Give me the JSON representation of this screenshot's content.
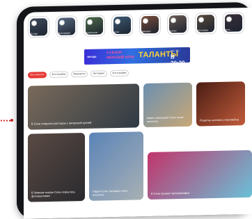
{
  "stories": [
    {
      "label": "Погода",
      "color": "#3f4a5a"
    },
    {
      "label": "Фотография",
      "color": "#5a6b83"
    },
    {
      "label": "Кыргызстан",
      "color": "#4e6b4a"
    },
    {
      "label": "Сочи",
      "color": "#3d5a74"
    },
    {
      "label": "Маршрут",
      "color": "#7a4d3a"
    },
    {
      "label": "Бизнес",
      "color": "#6a5a52"
    },
    {
      "label": "Рестораны",
      "color": "#574a3c"
    },
    {
      "label": "Ночь",
      "color": "#3a2f3a"
    }
  ],
  "banner": {
    "logo": "звезда",
    "line1": "4 СЕЗОН",
    "line2": "ЖЕНСКИЙ КЛУБ",
    "brand": "ТАЛАНТЫ",
    "days": "СБ / ВС",
    "time": "В 20:30"
  },
  "tabs": [
    {
      "label": "Все новости",
      "active": true
    },
    {
      "label": "Фотографии",
      "active": false
    },
    {
      "label": "Маршруты",
      "active": false
    },
    {
      "label": "Интервью",
      "active": false
    },
    {
      "label": "Фотографии",
      "active": false
    }
  ],
  "cards": [
    {
      "caption": "В Сочи открылся ресторан с авторской кухней",
      "colors": [
        "#7a6a5a",
        "#2f3a44"
      ]
    },
    {
      "caption": "Какие санатории Сочи стоит посетить",
      "colors": [
        "#6b8fb0",
        "#c9a876"
      ]
    },
    {
      "caption": "Рецепты осеннего глинтвейна",
      "colors": [
        "#4a1e14",
        "#c05a3a"
      ]
    },
    {
      "caption": "В Зимнем театре Сочи открылась фотовыставка",
      "colors": [
        "#5a4a44",
        "#2a2a2e"
      ]
    },
    {
      "caption": "Парки Сочи, которые стоит посетить",
      "colors": [
        "#5b84b8",
        "#a8b0b4"
      ]
    },
    {
      "caption": "В Сочи прошел веломарафон",
      "colors": [
        "#c2346a",
        "#6ac0d8"
      ]
    }
  ]
}
